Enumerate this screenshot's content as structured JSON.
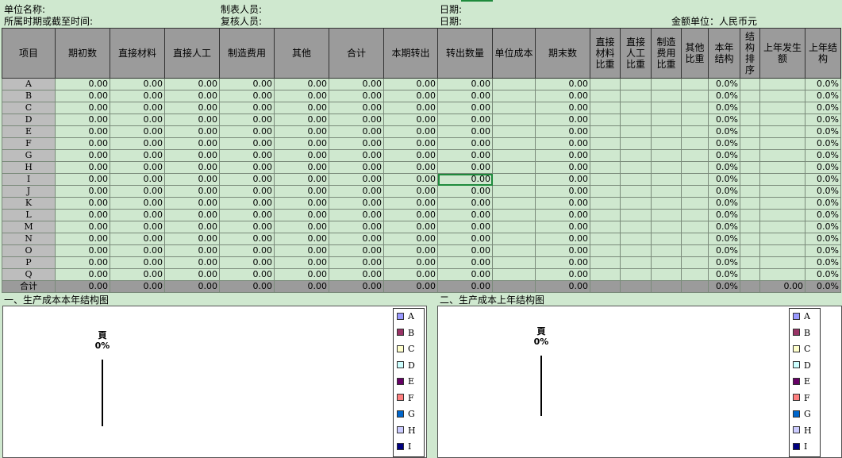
{
  "header": {
    "unit_name_label": "单位名称:",
    "period_label": "所属时期或截至时间:",
    "preparer_label": "制表人员:",
    "reviewer_label": "复核人员:",
    "date1_label": "日期:",
    "date2_label": "日期:",
    "currency_label": "金额单位：人民币元"
  },
  "columns": [
    "项目",
    "期初数",
    "直接材料",
    "直接人工",
    "制造费用",
    "其他",
    "合计",
    "本期转出",
    "转出数量",
    "单位成本",
    "期末数",
    "直接材料比重",
    "直接人工比重",
    "制造费用比重",
    "其他比重",
    "本年结构",
    "结构排序",
    "上年发生额",
    "上年结构"
  ],
  "rows": [
    {
      "label": "A",
      "cells": [
        "0.00",
        "0.00",
        "0.00",
        "0.00",
        "0.00",
        "0.00",
        "0.00",
        "0.00",
        "",
        "0.00",
        "",
        "",
        "",
        "",
        "0.0%",
        "",
        "",
        "0.0%"
      ]
    },
    {
      "label": "B",
      "cells": [
        "0.00",
        "0.00",
        "0.00",
        "0.00",
        "0.00",
        "0.00",
        "0.00",
        "0.00",
        "",
        "0.00",
        "",
        "",
        "",
        "",
        "0.0%",
        "",
        "",
        "0.0%"
      ]
    },
    {
      "label": "C",
      "cells": [
        "0.00",
        "0.00",
        "0.00",
        "0.00",
        "0.00",
        "0.00",
        "0.00",
        "0.00",
        "",
        "0.00",
        "",
        "",
        "",
        "",
        "0.0%",
        "",
        "",
        "0.0%"
      ]
    },
    {
      "label": "D",
      "cells": [
        "0.00",
        "0.00",
        "0.00",
        "0.00",
        "0.00",
        "0.00",
        "0.00",
        "0.00",
        "",
        "0.00",
        "",
        "",
        "",
        "",
        "0.0%",
        "",
        "",
        "0.0%"
      ]
    },
    {
      "label": "E",
      "cells": [
        "0.00",
        "0.00",
        "0.00",
        "0.00",
        "0.00",
        "0.00",
        "0.00",
        "0.00",
        "",
        "0.00",
        "",
        "",
        "",
        "",
        "0.0%",
        "",
        "",
        "0.0%"
      ]
    },
    {
      "label": "F",
      "cells": [
        "0.00",
        "0.00",
        "0.00",
        "0.00",
        "0.00",
        "0.00",
        "0.00",
        "0.00",
        "",
        "0.00",
        "",
        "",
        "",
        "",
        "0.0%",
        "",
        "",
        "0.0%"
      ]
    },
    {
      "label": "G",
      "cells": [
        "0.00",
        "0.00",
        "0.00",
        "0.00",
        "0.00",
        "0.00",
        "0.00",
        "0.00",
        "",
        "0.00",
        "",
        "",
        "",
        "",
        "0.0%",
        "",
        "",
        "0.0%"
      ]
    },
    {
      "label": "H",
      "cells": [
        "0.00",
        "0.00",
        "0.00",
        "0.00",
        "0.00",
        "0.00",
        "0.00",
        "0.00",
        "",
        "0.00",
        "",
        "",
        "",
        "",
        "0.0%",
        "",
        "",
        "0.0%"
      ]
    },
    {
      "label": "I",
      "cells": [
        "0.00",
        "0.00",
        "0.00",
        "0.00",
        "0.00",
        "0.00",
        "0.00",
        "0.00",
        "",
        "0.00",
        "",
        "",
        "",
        "",
        "0.0%",
        "",
        "",
        "0.0%"
      ]
    },
    {
      "label": "J",
      "cells": [
        "0.00",
        "0.00",
        "0.00",
        "0.00",
        "0.00",
        "0.00",
        "0.00",
        "0.00",
        "",
        "0.00",
        "",
        "",
        "",
        "",
        "0.0%",
        "",
        "",
        "0.0%"
      ]
    },
    {
      "label": "K",
      "cells": [
        "0.00",
        "0.00",
        "0.00",
        "0.00",
        "0.00",
        "0.00",
        "0.00",
        "0.00",
        "",
        "0.00",
        "",
        "",
        "",
        "",
        "0.0%",
        "",
        "",
        "0.0%"
      ]
    },
    {
      "label": "L",
      "cells": [
        "0.00",
        "0.00",
        "0.00",
        "0.00",
        "0.00",
        "0.00",
        "0.00",
        "0.00",
        "",
        "0.00",
        "",
        "",
        "",
        "",
        "0.0%",
        "",
        "",
        "0.0%"
      ]
    },
    {
      "label": "M",
      "cells": [
        "0.00",
        "0.00",
        "0.00",
        "0.00",
        "0.00",
        "0.00",
        "0.00",
        "0.00",
        "",
        "0.00",
        "",
        "",
        "",
        "",
        "0.0%",
        "",
        "",
        "0.0%"
      ]
    },
    {
      "label": "N",
      "cells": [
        "0.00",
        "0.00",
        "0.00",
        "0.00",
        "0.00",
        "0.00",
        "0.00",
        "0.00",
        "",
        "0.00",
        "",
        "",
        "",
        "",
        "0.0%",
        "",
        "",
        "0.0%"
      ]
    },
    {
      "label": "O",
      "cells": [
        "0.00",
        "0.00",
        "0.00",
        "0.00",
        "0.00",
        "0.00",
        "0.00",
        "0.00",
        "",
        "0.00",
        "",
        "",
        "",
        "",
        "0.0%",
        "",
        "",
        "0.0%"
      ]
    },
    {
      "label": "P",
      "cells": [
        "0.00",
        "0.00",
        "0.00",
        "0.00",
        "0.00",
        "0.00",
        "0.00",
        "0.00",
        "",
        "0.00",
        "",
        "",
        "",
        "",
        "0.0%",
        "",
        "",
        "0.0%"
      ]
    },
    {
      "label": "Q",
      "cells": [
        "0.00",
        "0.00",
        "0.00",
        "0.00",
        "0.00",
        "0.00",
        "0.00",
        "0.00",
        "",
        "0.00",
        "",
        "",
        "",
        "",
        "0.0%",
        "",
        "",
        "0.0%"
      ]
    },
    {
      "label": "合计",
      "cells": [
        "0.00",
        "0.00",
        "0.00",
        "0.00",
        "0.00",
        "0.00",
        "0.00",
        "0.00",
        "",
        "0.00",
        "",
        "",
        "",
        "",
        "0.0%",
        "",
        "0.00",
        "0.0%"
      ]
    }
  ],
  "charts": {
    "current_title": "一、生产成本本年结构图",
    "previous_title": "二、生产成本上年结构图",
    "current_pie_label_top": "頁",
    "current_pie_label_pct": "0%",
    "previous_pie_label_top": "頁",
    "previous_pie_label_pct": "0%",
    "legend": [
      {
        "label": "A",
        "color": "#9999ff"
      },
      {
        "label": "B",
        "color": "#993366"
      },
      {
        "label": "C",
        "color": "#ffffcc"
      },
      {
        "label": "D",
        "color": "#ccffff"
      },
      {
        "label": "E",
        "color": "#660066"
      },
      {
        "label": "F",
        "color": "#ff8080"
      },
      {
        "label": "G",
        "color": "#0066cc"
      },
      {
        "label": "H",
        "color": "#ccccff"
      },
      {
        "label": "I",
        "color": "#000080"
      }
    ]
  }
}
